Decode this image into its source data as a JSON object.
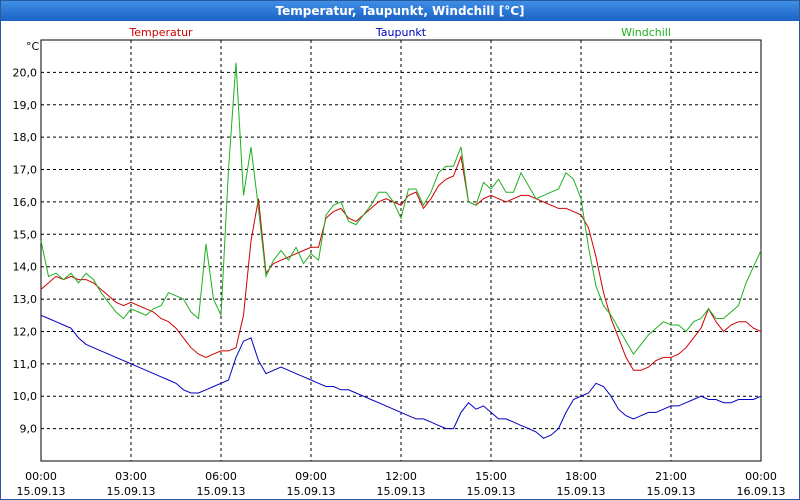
{
  "window": {
    "title": "Temperatur, Taupunkt, Windchill [°C]"
  },
  "chart_data": {
    "type": "line",
    "title": "Temperatur, Taupunkt, Windchill [°C]",
    "ylabel": "°C",
    "xlabel": "",
    "ylim": [
      8.0,
      21.0
    ],
    "y_ticks": [
      "9,0",
      "10,0",
      "11,0",
      "12,0",
      "13,0",
      "14,0",
      "15,0",
      "16,0",
      "17,0",
      "18,0",
      "19,0",
      "20,0"
    ],
    "y_tick_values": [
      9,
      10,
      11,
      12,
      13,
      14,
      15,
      16,
      17,
      18,
      19,
      20
    ],
    "x_ticks": [
      {
        "time": "00:00",
        "date": "15.09.13"
      },
      {
        "time": "03:00",
        "date": "15.09.13"
      },
      {
        "time": "06:00",
        "date": "15.09.13"
      },
      {
        "time": "09:00",
        "date": "15.09.13"
      },
      {
        "time": "12:00",
        "date": "15.09.13"
      },
      {
        "time": "15:00",
        "date": "15.09.13"
      },
      {
        "time": "18:00",
        "date": "15.09.13"
      },
      {
        "time": "21:00",
        "date": "15.09.13"
      },
      {
        "time": "00:00",
        "date": "16.09.13"
      }
    ],
    "xlim_hours": [
      0,
      24
    ],
    "grid": true,
    "legend_placement": "top",
    "x_hours": [
      0,
      0.25,
      0.5,
      0.75,
      1,
      1.25,
      1.5,
      1.75,
      2,
      2.25,
      2.5,
      2.75,
      3,
      3.25,
      3.5,
      3.75,
      4,
      4.25,
      4.5,
      4.75,
      5,
      5.25,
      5.5,
      5.75,
      6,
      6.25,
      6.5,
      6.75,
      7,
      7.25,
      7.5,
      7.75,
      8,
      8.25,
      8.5,
      8.75,
      9,
      9.25,
      9.5,
      9.75,
      10,
      10.25,
      10.5,
      10.75,
      11,
      11.25,
      11.5,
      11.75,
      12,
      12.25,
      12.5,
      12.75,
      13,
      13.25,
      13.5,
      13.75,
      14,
      14.25,
      14.5,
      14.75,
      15,
      15.25,
      15.5,
      15.75,
      16,
      16.25,
      16.5,
      16.75,
      17,
      17.25,
      17.5,
      17.75,
      18,
      18.25,
      18.5,
      18.75,
      19,
      19.25,
      19.5,
      19.75,
      20,
      20.25,
      20.5,
      20.75,
      21,
      21.25,
      21.5,
      21.75,
      22,
      22.25,
      22.5,
      22.75,
      23,
      23.25,
      23.5,
      23.75,
      24
    ],
    "series": [
      {
        "name": "Temperatur",
        "color": "#d00000",
        "values": [
          13.3,
          13.5,
          13.7,
          13.6,
          13.7,
          13.6,
          13.6,
          13.5,
          13.3,
          13.1,
          12.9,
          12.8,
          12.9,
          12.8,
          12.7,
          12.6,
          12.4,
          12.3,
          12.1,
          11.8,
          11.5,
          11.3,
          11.2,
          11.3,
          11.4,
          11.4,
          11.5,
          12.5,
          14.8,
          16.1,
          13.8,
          14.1,
          14.2,
          14.3,
          14.4,
          14.5,
          14.6,
          14.6,
          15.5,
          15.7,
          15.8,
          15.5,
          15.4,
          15.6,
          15.8,
          16.0,
          16.1,
          16.0,
          15.9,
          16.2,
          16.3,
          15.8,
          16.1,
          16.5,
          16.7,
          16.8,
          17.4,
          16.0,
          15.9,
          16.1,
          16.2,
          16.1,
          16.0,
          16.1,
          16.2,
          16.2,
          16.1,
          16.0,
          15.9,
          15.8,
          15.8,
          15.7,
          15.6,
          15.2,
          14.3,
          13.2,
          12.4,
          11.8,
          11.2,
          10.8,
          10.8,
          10.9,
          11.1,
          11.2,
          11.2,
          11.3,
          11.5,
          11.8,
          12.1,
          12.7,
          12.3,
          12.0,
          12.2,
          12.3,
          12.3,
          12.1,
          12.0
        ]
      },
      {
        "name": "Taupunkt",
        "color": "#0000c0",
        "values": [
          12.5,
          12.4,
          12.3,
          12.2,
          12.1,
          11.8,
          11.6,
          11.5,
          11.4,
          11.3,
          11.2,
          11.1,
          11.0,
          10.9,
          10.8,
          10.7,
          10.6,
          10.5,
          10.4,
          10.2,
          10.1,
          10.1,
          10.2,
          10.3,
          10.4,
          10.5,
          11.2,
          11.7,
          11.8,
          11.1,
          10.7,
          10.8,
          10.9,
          10.8,
          10.7,
          10.6,
          10.5,
          10.4,
          10.3,
          10.3,
          10.2,
          10.2,
          10.1,
          10.0,
          9.9,
          9.8,
          9.7,
          9.6,
          9.5,
          9.4,
          9.3,
          9.3,
          9.2,
          9.1,
          9.0,
          9.0,
          9.5,
          9.8,
          9.6,
          9.7,
          9.5,
          9.3,
          9.3,
          9.2,
          9.1,
          9.0,
          8.9,
          8.7,
          8.8,
          9.0,
          9.5,
          9.9,
          10.0,
          10.1,
          10.4,
          10.3,
          10.0,
          9.6,
          9.4,
          9.3,
          9.4,
          9.5,
          9.5,
          9.6,
          9.7,
          9.7,
          9.8,
          9.9,
          10.0,
          9.9,
          9.9,
          9.8,
          9.8,
          9.9,
          9.9,
          9.9,
          10.0
        ]
      },
      {
        "name": "Windchill",
        "color": "#20b020",
        "values": [
          14.8,
          13.7,
          13.8,
          13.6,
          13.8,
          13.5,
          13.8,
          13.6,
          13.2,
          12.9,
          12.6,
          12.4,
          12.7,
          12.6,
          12.5,
          12.7,
          12.8,
          13.2,
          13.1,
          13.0,
          12.6,
          12.4,
          14.7,
          13.0,
          12.5,
          17.0,
          20.3,
          16.2,
          17.7,
          15.8,
          13.7,
          14.2,
          14.5,
          14.2,
          14.6,
          14.1,
          14.4,
          14.2,
          15.6,
          15.9,
          16.0,
          15.4,
          15.3,
          15.6,
          15.9,
          16.3,
          16.3,
          16.0,
          15.5,
          16.4,
          16.4,
          15.9,
          16.3,
          16.9,
          17.1,
          17.1,
          17.7,
          16.0,
          15.9,
          16.6,
          16.4,
          16.7,
          16.3,
          16.3,
          16.9,
          16.5,
          16.1,
          16.2,
          16.3,
          16.4,
          16.9,
          16.7,
          16.1,
          14.6,
          13.4,
          12.8,
          12.5,
          12.1,
          11.7,
          11.3,
          11.6,
          11.9,
          12.1,
          12.3,
          12.2,
          12.2,
          12.0,
          12.3,
          12.4,
          12.7,
          12.4,
          12.4,
          12.6,
          12.8,
          13.5,
          14.0,
          14.5
        ]
      }
    ]
  }
}
